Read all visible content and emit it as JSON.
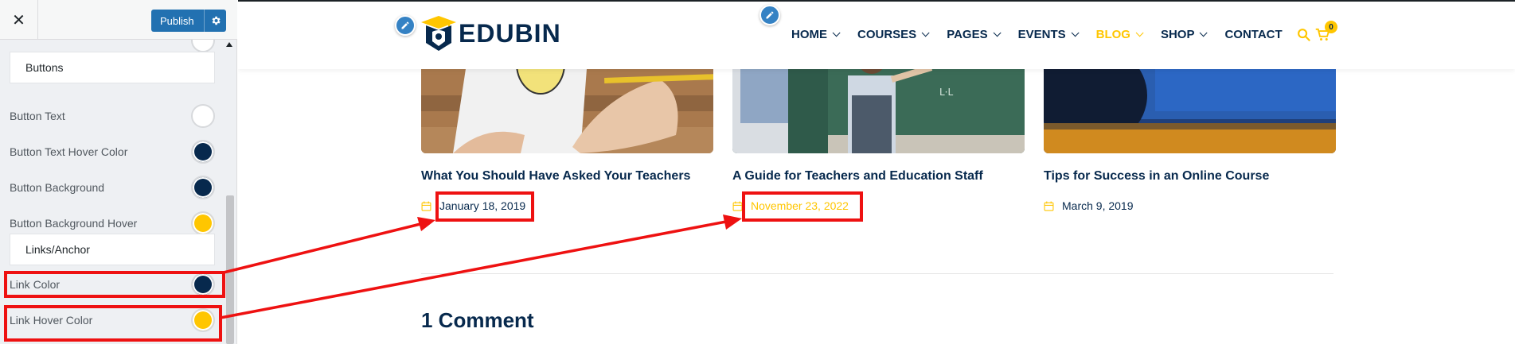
{
  "customizer": {
    "close_icon": "close-icon",
    "publish_label": "Publish",
    "sections": {
      "buttons": "Buttons",
      "links": "Links/Anchor"
    },
    "controls": [
      {
        "label": "Button Text",
        "color": "#ffffff"
      },
      {
        "label": "Button Text Hover Color",
        "color": "#07294d"
      },
      {
        "label": "Button Background",
        "color": "#07294d"
      },
      {
        "label": "Button Background Hover",
        "color": "#ffc600"
      }
    ],
    "link_controls": [
      {
        "label": "Link Color",
        "color": "#07294d"
      },
      {
        "label": "Link Hover Color",
        "color": "#ffc600"
      }
    ]
  },
  "site": {
    "logo": "EDUBIN",
    "nav": [
      {
        "label": "HOME",
        "dropdown": true
      },
      {
        "label": "COURSES",
        "dropdown": true
      },
      {
        "label": "PAGES",
        "dropdown": true
      },
      {
        "label": "EVENTS",
        "dropdown": true
      },
      {
        "label": "BLOG",
        "dropdown": true,
        "active": true
      },
      {
        "label": "SHOP",
        "dropdown": true
      },
      {
        "label": "CONTACT",
        "dropdown": false
      }
    ],
    "cart_count": "0",
    "colors": {
      "primary": "#07294d",
      "accent": "#ffc600"
    },
    "posts": [
      {
        "title": "What You Should Have Asked Your Teachers",
        "date": "January 18, 2019",
        "state": "normal"
      },
      {
        "title": "A Guide for Teachers and Education Staff",
        "date": "November 23, 2022",
        "state": "hover"
      },
      {
        "title": "Tips for Success in an Online Course",
        "date": "March 9, 2019",
        "state": "normal"
      }
    ],
    "comments_title": "1 Comment"
  }
}
